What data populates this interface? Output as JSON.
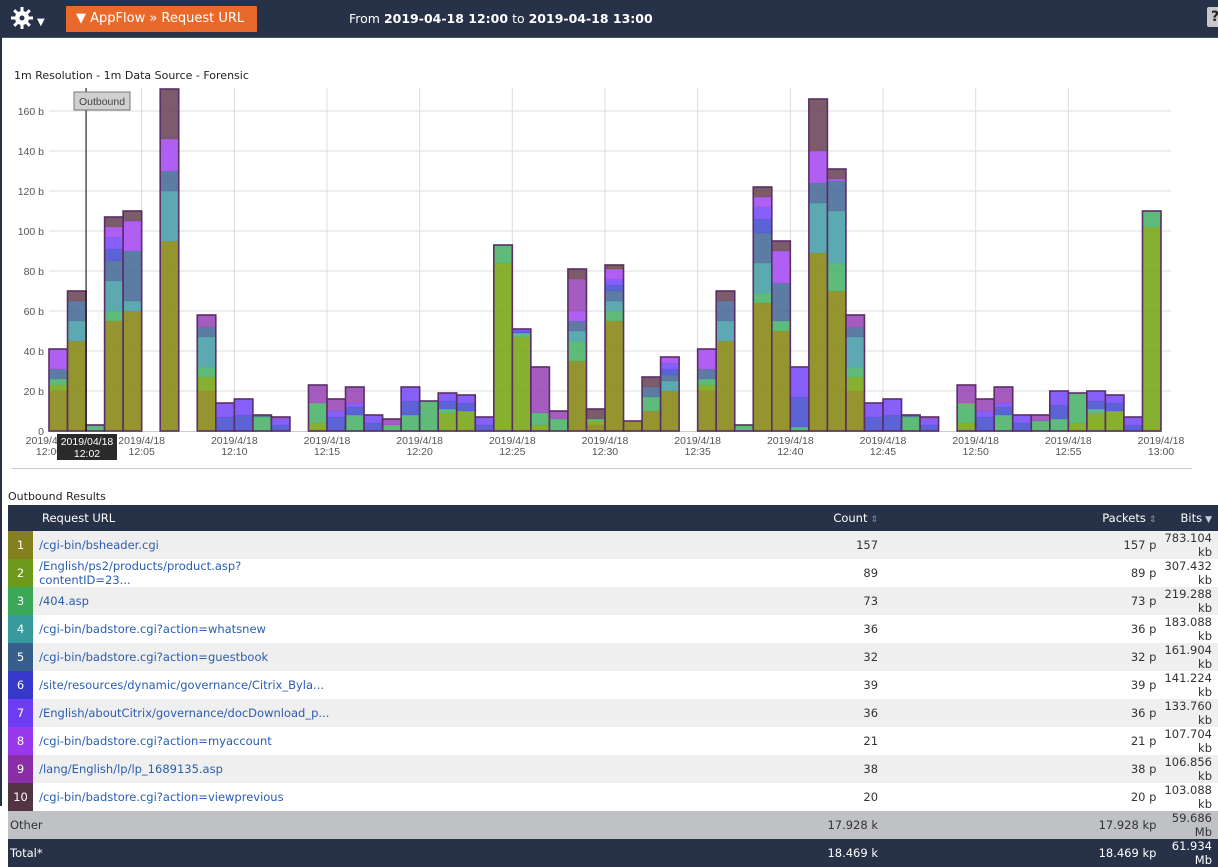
{
  "header": {
    "app_button": "▼ AppFlow » Request URL",
    "range_from_label": "From",
    "range_from": "2019-04-18 12:00",
    "range_to_label": "to",
    "range_to": "2019-04-18 13:00",
    "help": "?"
  },
  "resolution_label": "1m Resolution - 1m Data Source - Forensic",
  "chart_data": {
    "type": "bar",
    "stacked": true,
    "title": "1m Resolution - 1m Data Source - Forensic",
    "xlabel": "",
    "ylabel": "",
    "ylim": [
      0,
      170
    ],
    "yticks": [
      "0",
      "20 b",
      "40 b",
      "60 b",
      "80 b",
      "100 b",
      "120 b",
      "140 b",
      "160 b"
    ],
    "ytick_values": [
      0,
      20,
      40,
      60,
      80,
      100,
      120,
      140,
      160
    ],
    "xtick_labels": [
      [
        "2019/4/18",
        "12:00"
      ],
      [
        "2019/4/18",
        "12:05"
      ],
      [
        "2019/4/18",
        "12:10"
      ],
      [
        "2019/4/18",
        "12:15"
      ],
      [
        "2019/4/18",
        "12:20"
      ],
      [
        "2019/4/18",
        "12:25"
      ],
      [
        "2019/4/18",
        "12:30"
      ],
      [
        "2019/4/18",
        "12:35"
      ],
      [
        "2019/4/18",
        "12:40"
      ],
      [
        "2019/4/18",
        "12:45"
      ],
      [
        "2019/4/18",
        "12:50"
      ],
      [
        "2019/4/18",
        "12:55"
      ],
      [
        "2019/4/18",
        "13:00"
      ]
    ],
    "xtick_minutes": [
      0,
      5,
      10,
      15,
      20,
      25,
      30,
      35,
      40,
      45,
      50,
      55,
      60
    ],
    "grid": true,
    "crosshair": {
      "label": "Outbound",
      "tooltip_line1": "2019/04/18",
      "tooltip_line2": "12:02",
      "minute": 2
    },
    "series_colors": [
      "#8a8a1a",
      "#7aa61a",
      "#4cb46a",
      "#4aa0a8",
      "#4a6e9a",
      "#4a52d0",
      "#7a4ef8",
      "#a64ef0",
      "#9a4ab8",
      "#6e4a5a"
    ],
    "series_names": [
      "/cgi-bin/bsheader.cgi",
      "/English/ps2/products/product.asp?contentID=23...",
      "/404.asp",
      "/cgi-bin/badstore.cgi?action=whatsnew",
      "/cgi-bin/badstore.cgi?action=guestbook",
      "/site/resources/dynamic/governance/Citrix_Byla...",
      "/English/aboutCitrix/governance/docDownload_p...",
      "/cgi-bin/badstore.cgi?action=myaccount",
      "/lang/English/lp/lp_1689135.asp",
      "/cgi-bin/badstore.cgi?action=viewprevious"
    ],
    "bars": [
      [
        20,
        3,
        3,
        0,
        5,
        0,
        0,
        10,
        0,
        0
      ],
      [
        45,
        0,
        0,
        10,
        10,
        0,
        0,
        0,
        0,
        5
      ],
      [
        0,
        0,
        3,
        0,
        0,
        0,
        0,
        0,
        0,
        0
      ],
      [
        55,
        0,
        5,
        15,
        10,
        6,
        6,
        5,
        0,
        5
      ],
      [
        60,
        0,
        0,
        5,
        25,
        0,
        0,
        15,
        0,
        5
      ],
      [
        0,
        0,
        0,
        0,
        0,
        0,
        0,
        0,
        0,
        0
      ],
      [
        95,
        0,
        0,
        25,
        10,
        0,
        0,
        16,
        0,
        25
      ],
      [
        0,
        0,
        0,
        0,
        0,
        0,
        0,
        0,
        0,
        0
      ],
      [
        20,
        7,
        5,
        15,
        5,
        0,
        0,
        0,
        6,
        0
      ],
      [
        0,
        0,
        0,
        0,
        0,
        7,
        7,
        0,
        0,
        0
      ],
      [
        0,
        0,
        0,
        0,
        0,
        8,
        8,
        0,
        0,
        0
      ],
      [
        0,
        0,
        7,
        0,
        1,
        0,
        0,
        0,
        0,
        0
      ],
      [
        0,
        0,
        0,
        0,
        0,
        3,
        3,
        0,
        1,
        0
      ],
      [
        0,
        0,
        0,
        0,
        0,
        0,
        0,
        0,
        0,
        0
      ],
      [
        0,
        4,
        10,
        0,
        0,
        0,
        0,
        0,
        9,
        0
      ],
      [
        0,
        0,
        0,
        0,
        0,
        7,
        3,
        0,
        6,
        0
      ],
      [
        0,
        0,
        8,
        0,
        0,
        4,
        2,
        0,
        8,
        0
      ],
      [
        0,
        0,
        0,
        0,
        0,
        4,
        4,
        0,
        0,
        0
      ],
      [
        0,
        0,
        3,
        0,
        0,
        0,
        0,
        0,
        3,
        0
      ],
      [
        0,
        0,
        8,
        0,
        0,
        7,
        7,
        0,
        0,
        0
      ],
      [
        0,
        0,
        15,
        0,
        0,
        0,
        0,
        0,
        0,
        0
      ],
      [
        0,
        9,
        2,
        0,
        0,
        4,
        4,
        0,
        0,
        0
      ],
      [
        0,
        10,
        0,
        0,
        0,
        4,
        4,
        0,
        0,
        0
      ],
      [
        0,
        0,
        0,
        0,
        0,
        3,
        4,
        0,
        0,
        0
      ],
      [
        0,
        84,
        9,
        0,
        0,
        0,
        0,
        0,
        0,
        0
      ],
      [
        0,
        47,
        2,
        0,
        0,
        1,
        1,
        0,
        0,
        0
      ],
      [
        0,
        3,
        6,
        0,
        0,
        0,
        0,
        0,
        23,
        0
      ],
      [
        0,
        0,
        6,
        0,
        0,
        0,
        0,
        0,
        4,
        0
      ],
      [
        35,
        0,
        10,
        5,
        5,
        0,
        0,
        5,
        16,
        5
      ],
      [
        3,
        2,
        1,
        0,
        0,
        0,
        0,
        0,
        0,
        5
      ],
      [
        55,
        0,
        5,
        5,
        5,
        3,
        3,
        5,
        0,
        2
      ],
      [
        5,
        0,
        0,
        0,
        0,
        0,
        0,
        0,
        0,
        0
      ],
      [
        10,
        0,
        7,
        0,
        5,
        0,
        0,
        0,
        0,
        5
      ],
      [
        20,
        0,
        0,
        5,
        3,
        3,
        3,
        3,
        0,
        0
      ],
      [
        0,
        0,
        0,
        0,
        0,
        0,
        0,
        0,
        0,
        0
      ],
      [
        20,
        3,
        3,
        0,
        5,
        0,
        0,
        10,
        0,
        0
      ],
      [
        45,
        0,
        0,
        10,
        10,
        0,
        0,
        0,
        0,
        5
      ],
      [
        0,
        0,
        3,
        0,
        0,
        0,
        0,
        0,
        0,
        0
      ],
      [
        64,
        0,
        5,
        15,
        15,
        7,
        6,
        5,
        0,
        5
      ],
      [
        50,
        0,
        5,
        0,
        19,
        0,
        0,
        16,
        0,
        5
      ],
      [
        0,
        0,
        2,
        0,
        0,
        15,
        15,
        0,
        0,
        0
      ],
      [
        89,
        0,
        0,
        25,
        10,
        0,
        0,
        16,
        0,
        26
      ],
      [
        70,
        0,
        14,
        26,
        15,
        0,
        0,
        1,
        0,
        5
      ],
      [
        20,
        7,
        5,
        15,
        5,
        0,
        0,
        0,
        6,
        0
      ],
      [
        0,
        0,
        0,
        0,
        0,
        7,
        7,
        0,
        0,
        0
      ],
      [
        0,
        0,
        0,
        0,
        0,
        8,
        8,
        0,
        0,
        0
      ],
      [
        0,
        0,
        7,
        0,
        1,
        0,
        0,
        0,
        0,
        0
      ],
      [
        0,
        0,
        0,
        0,
        0,
        3,
        3,
        0,
        1,
        0
      ],
      [
        0,
        0,
        0,
        0,
        0,
        0,
        0,
        0,
        0,
        0
      ],
      [
        0,
        4,
        10,
        0,
        0,
        0,
        0,
        0,
        9,
        0
      ],
      [
        0,
        0,
        0,
        0,
        0,
        7,
        3,
        0,
        6,
        0
      ],
      [
        0,
        0,
        8,
        0,
        0,
        4,
        2,
        0,
        8,
        0
      ],
      [
        0,
        0,
        0,
        0,
        0,
        4,
        4,
        0,
        0,
        0
      ],
      [
        0,
        0,
        5,
        0,
        0,
        0,
        0,
        0,
        3,
        0
      ],
      [
        0,
        0,
        6,
        0,
        0,
        7,
        7,
        0,
        0,
        0
      ],
      [
        0,
        4,
        15,
        0,
        0,
        0,
        0,
        0,
        0,
        0
      ],
      [
        0,
        9,
        2,
        0,
        0,
        4,
        5,
        0,
        0,
        0
      ],
      [
        0,
        10,
        0,
        0,
        0,
        4,
        4,
        0,
        0,
        0
      ],
      [
        0,
        0,
        0,
        0,
        0,
        3,
        4,
        0,
        0,
        0
      ],
      [
        0,
        102,
        8,
        0,
        0,
        0,
        0,
        0,
        0,
        0
      ]
    ]
  },
  "results": {
    "title": "Outbound Results",
    "columns": {
      "url": "Request URL",
      "count": "Count",
      "packets": "Packets",
      "bits": "Bits"
    },
    "rows": [
      {
        "idx": "1",
        "color": "#85801e",
        "url": "/cgi-bin/bsheader.cgi",
        "count": "157",
        "packets": "157 p",
        "bits": "783.104 kb"
      },
      {
        "idx": "2",
        "color": "#6e9a1c",
        "url": "/English/ps2/products/product.asp?contentID=23...",
        "count": "89",
        "packets": "89 p",
        "bits": "307.432 kb"
      },
      {
        "idx": "3",
        "color": "#3aa857",
        "url": "/404.asp",
        "count": "73",
        "packets": "73 p",
        "bits": "219.288 kb"
      },
      {
        "idx": "4",
        "color": "#379a9c",
        "url": "/cgi-bin/badstore.cgi?action=whatsnew",
        "count": "36",
        "packets": "36 p",
        "bits": "183.088 kb"
      },
      {
        "idx": "5",
        "color": "#365f8c",
        "url": "/cgi-bin/badstore.cgi?action=guestbook",
        "count": "32",
        "packets": "32 p",
        "bits": "161.904 kb"
      },
      {
        "idx": "6",
        "color": "#3538c8",
        "url": "/site/resources/dynamic/governance/Citrix_Byla...",
        "count": "39",
        "packets": "39 p",
        "bits": "141.224 kb"
      },
      {
        "idx": "7",
        "color": "#6c3cf2",
        "url": "/English/aboutCitrix/governance/docDownload_p...",
        "count": "36",
        "packets": "36 p",
        "bits": "133.760 kb"
      },
      {
        "idx": "8",
        "color": "#9a38ec",
        "url": "/cgi-bin/badstore.cgi?action=myaccount",
        "count": "21",
        "packets": "21 p",
        "bits": "107.704 kb"
      },
      {
        "idx": "9",
        "color": "#8a2ea8",
        "url": "/lang/English/lp/lp_1689135.asp",
        "count": "38",
        "packets": "38 p",
        "bits": "106.856 kb"
      },
      {
        "idx": "10",
        "color": "#523442",
        "url": "/cgi-bin/badstore.cgi?action=viewprevious",
        "count": "20",
        "packets": "20 p",
        "bits": "103.088 kb"
      }
    ],
    "other": {
      "label": "Other",
      "count": "17.928 k",
      "packets": "17.928 kp",
      "bits": "59.686 Mb"
    },
    "total": {
      "label": "Total*",
      "count": "18.469 k",
      "packets": "18.469 kp",
      "bits": "61.934 Mb"
    }
  }
}
